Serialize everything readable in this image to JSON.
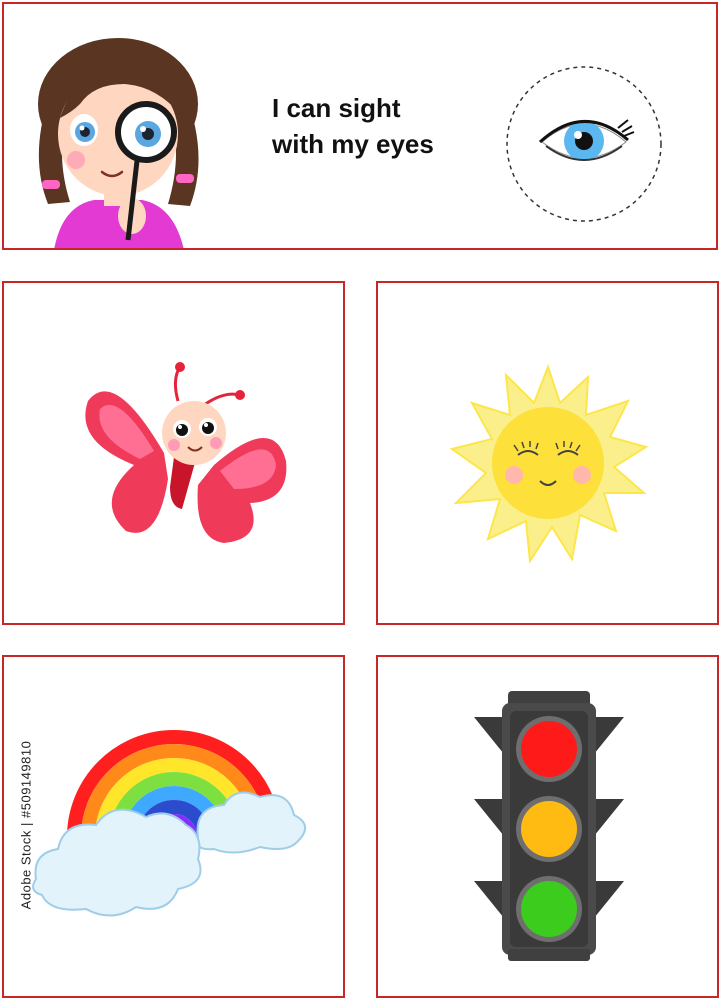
{
  "header": {
    "line1": "I can sight",
    "line2": "with my eyes"
  },
  "cards": [
    {
      "subject": "butterfly"
    },
    {
      "subject": "sun"
    },
    {
      "subject": "rainbow"
    },
    {
      "subject": "traffic-light"
    }
  ],
  "watermark": {
    "id_text": "Adobe Stock | #509149810"
  },
  "colors": {
    "border": "#c62828",
    "skin": "#ffd7c0",
    "hair": "#5a3522",
    "shirt": "#e23ad2",
    "eye_iris": "#5aa6e0",
    "butterfly_wing": "#f03a5a",
    "sun": "#fce64a",
    "traffic_red": "#ff1a1a",
    "traffic_amber": "#ffbb12",
    "traffic_green": "#3bcc1e"
  }
}
